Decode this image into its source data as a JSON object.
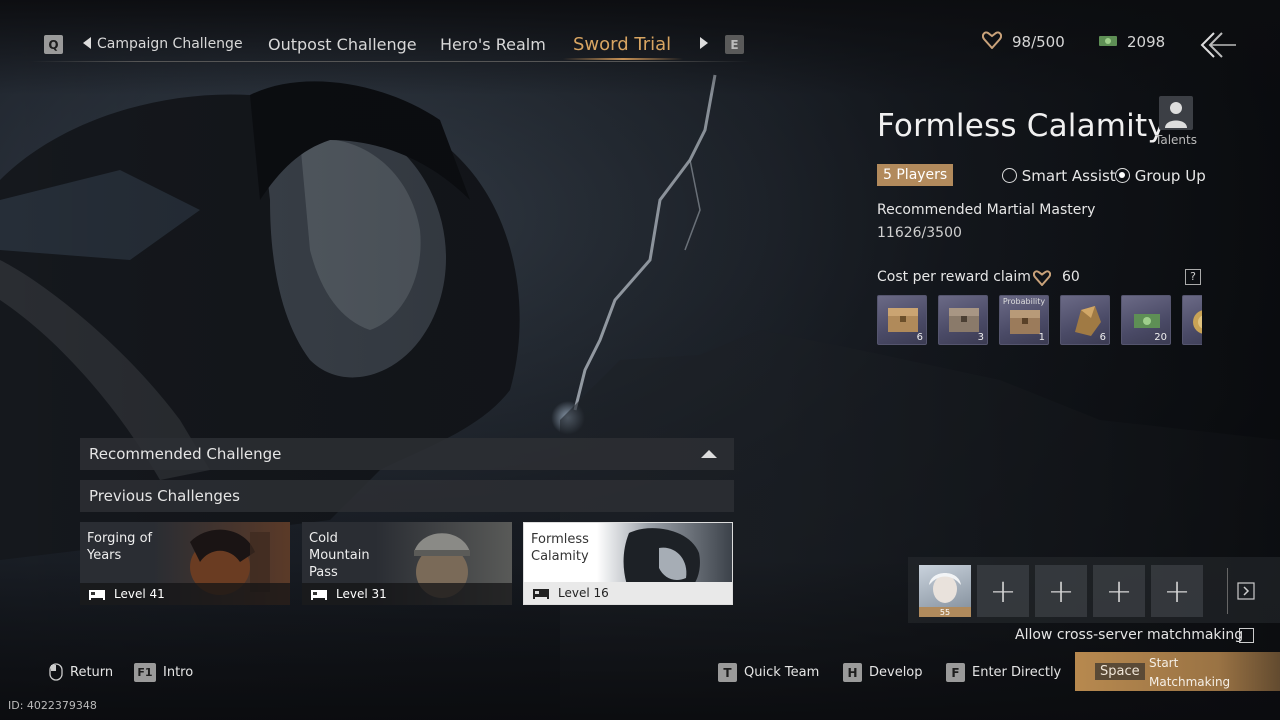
{
  "top_bar": {
    "left_key": "Q",
    "right_key": "E",
    "tabs": [
      {
        "label": "Campaign Challenge"
      },
      {
        "label": "Outpost Challenge"
      },
      {
        "label": "Hero's Realm"
      },
      {
        "label": "Sword Trial"
      }
    ],
    "active_tab": "Sword Trial",
    "currency_1": "98/500",
    "currency_2": "2098"
  },
  "panel": {
    "title": "Formless Calamity",
    "talents_label": "Talents",
    "players_badge": "5 Players",
    "option_smart_assist": "Smart Assist",
    "option_group_up": "Group Up",
    "selected_option": "Group Up",
    "mastery_label": "Recommended Martial Mastery",
    "mastery_value": "11626/3500",
    "cost_label": "Cost per reward claim",
    "cost_value": "60",
    "help_symbol": "?",
    "rewards": [
      {
        "icon": "chest-icon",
        "count": "6"
      },
      {
        "icon": "chest-icon",
        "count": "3"
      },
      {
        "icon": "chest-icon",
        "count": "1",
        "tag": "Probability"
      },
      {
        "icon": "ore-icon",
        "count": "6"
      },
      {
        "icon": "cash-icon",
        "count": "20"
      },
      {
        "icon": "coin-icon",
        "count": ""
      }
    ]
  },
  "challenges": {
    "recommended_label": "Recommended Challenge",
    "previous_label": "Previous Challenges",
    "cards": [
      {
        "name": "Forging of Years",
        "level": "Level 41"
      },
      {
        "name": "Cold Mountain Pass",
        "level": "Level 31"
      },
      {
        "name": "Formless Calamity",
        "level": "Level 16",
        "selected": true
      }
    ]
  },
  "team": {
    "player_level": "55",
    "empty_slot_symbol": "+",
    "cross_server_label": "Allow cross-server matchmaking"
  },
  "bottom_bar": {
    "return_label": "Return",
    "intro_key": "F1",
    "intro_label": "Intro",
    "quick_team_key": "T",
    "quick_team_label": "Quick Team",
    "develop_key": "H",
    "develop_label": "Develop",
    "enter_key": "F",
    "enter_label": "Enter Directly",
    "start_key": "Space",
    "start_label_1": "Start",
    "start_label_2": "Matchmaking",
    "id_text": "ID: 4022379348"
  },
  "colors": {
    "accent": "#d8a562",
    "badge": "#b28a5c",
    "start_button": "#b7894f"
  }
}
